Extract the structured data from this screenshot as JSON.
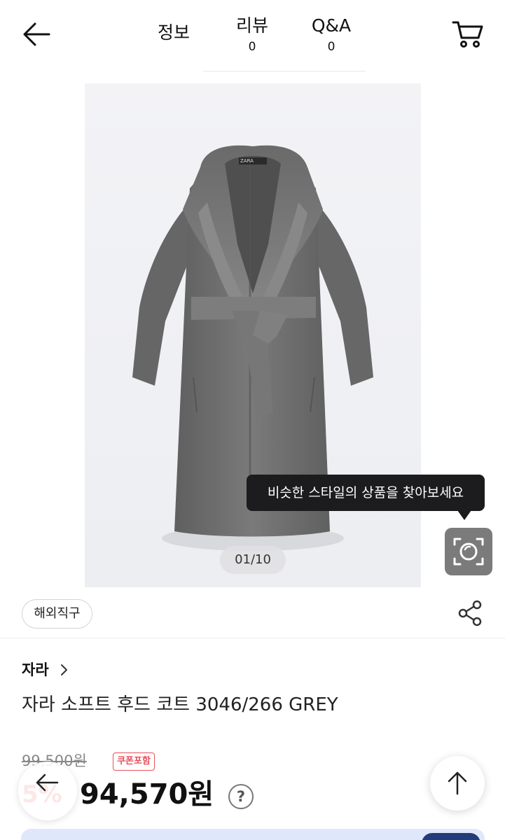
{
  "header": {
    "tabs": [
      {
        "label": "정보"
      },
      {
        "label": "리뷰",
        "count": "0"
      },
      {
        "label": "Q&A",
        "count": "0"
      }
    ]
  },
  "gallery": {
    "counter": "01/10",
    "image_brand_label": "ZARA",
    "tooltip": "비슷한 스타일의 상품을 찾아보세요"
  },
  "badges": {
    "overseas": "해외직구"
  },
  "product": {
    "brand": "자라",
    "title": "자라 소프트 후드 코트 3046/266 GREY",
    "original_price": "99,500원",
    "coupon_badge": "쿠폰포함",
    "discount_rate": "5%",
    "sale_price": "94,570원",
    "help_icon": "?"
  },
  "icons": {
    "back": "arrow-left-icon",
    "cart": "cart-icon",
    "lens": "lens-search-icon",
    "share": "share-icon",
    "brand_more": "chevron-right-icon",
    "scroll_top": "arrow-up-icon"
  },
  "colors": {
    "discount": "#e8383f",
    "coupon": "#e8505b",
    "tooltip_bg": "#1c1c1e",
    "coat": "#6f6f6f"
  }
}
